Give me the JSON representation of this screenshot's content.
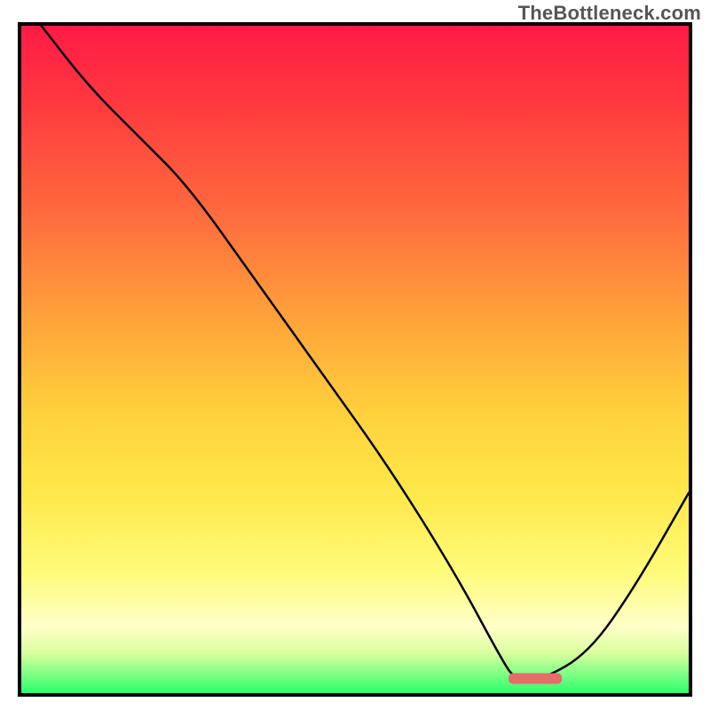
{
  "watermark": "TheBottleneck.com",
  "chart_data": {
    "type": "line",
    "title": "",
    "xlabel": "",
    "ylabel": "",
    "xlim": [
      0,
      100
    ],
    "ylim": [
      0,
      100
    ],
    "grid": false,
    "legend": false,
    "x": [
      3,
      10,
      18,
      25,
      35,
      45,
      55,
      65,
      72,
      74,
      78,
      85,
      92,
      100
    ],
    "values": [
      100,
      91,
      83,
      76,
      62,
      48,
      34,
      18,
      5,
      2,
      2,
      6,
      16,
      30
    ],
    "highlight_range_x": [
      73,
      81
    ],
    "highlight_y": 2.2,
    "background_gradient": {
      "top": "#ff1a46",
      "mid": "#ffd13c",
      "bottom": "#2cff6c"
    }
  }
}
